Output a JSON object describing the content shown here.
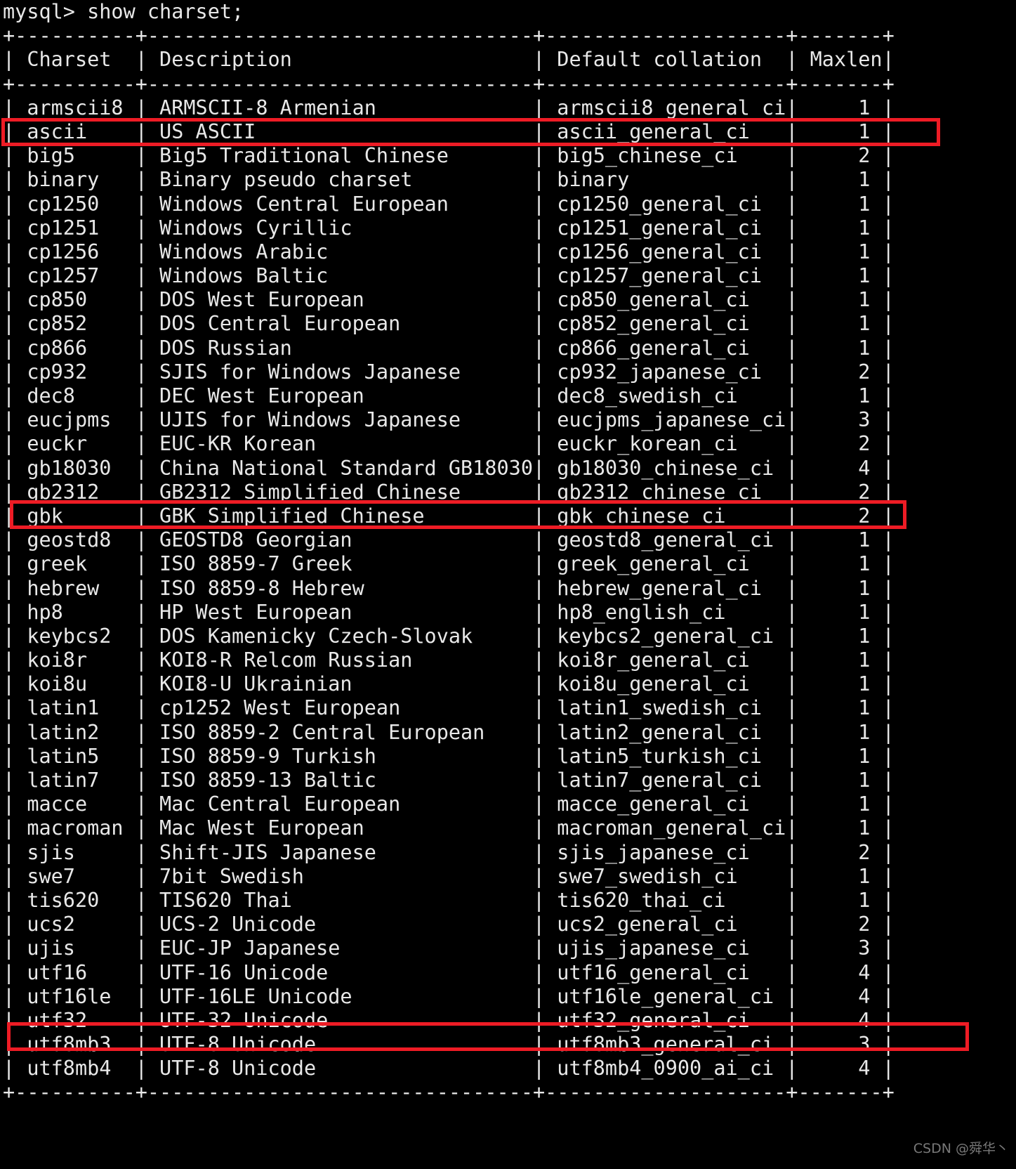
{
  "terminal": {
    "prompt": "mysql> show charset;",
    "separator": "+-----------+---------------------------------+---------------------+--------+",
    "header": {
      "charset": "Charset",
      "description": "Description",
      "collation": "Default collation",
      "maxlen": "Maxlen"
    },
    "columns": {
      "charset_width": 10,
      "description_width": 32,
      "collation_width": 20,
      "maxlen_width": 7
    },
    "rows": [
      {
        "charset": "armscii8",
        "description": "ARMSCII-8 Armenian",
        "collation": "armscii8_general_ci",
        "maxlen": "1",
        "highlighted": false
      },
      {
        "charset": "ascii",
        "description": "US ASCII",
        "collation": "ascii_general_ci",
        "maxlen": "1",
        "highlighted": true
      },
      {
        "charset": "big5",
        "description": "Big5 Traditional Chinese",
        "collation": "big5_chinese_ci",
        "maxlen": "2",
        "highlighted": false
      },
      {
        "charset": "binary",
        "description": "Binary pseudo charset",
        "collation": "binary",
        "maxlen": "1",
        "highlighted": false
      },
      {
        "charset": "cp1250",
        "description": "Windows Central European",
        "collation": "cp1250_general_ci",
        "maxlen": "1",
        "highlighted": false
      },
      {
        "charset": "cp1251",
        "description": "Windows Cyrillic",
        "collation": "cp1251_general_ci",
        "maxlen": "1",
        "highlighted": false
      },
      {
        "charset": "cp1256",
        "description": "Windows Arabic",
        "collation": "cp1256_general_ci",
        "maxlen": "1",
        "highlighted": false
      },
      {
        "charset": "cp1257",
        "description": "Windows Baltic",
        "collation": "cp1257_general_ci",
        "maxlen": "1",
        "highlighted": false
      },
      {
        "charset": "cp850",
        "description": "DOS West European",
        "collation": "cp850_general_ci",
        "maxlen": "1",
        "highlighted": false
      },
      {
        "charset": "cp852",
        "description": "DOS Central European",
        "collation": "cp852_general_ci",
        "maxlen": "1",
        "highlighted": false
      },
      {
        "charset": "cp866",
        "description": "DOS Russian",
        "collation": "cp866_general_ci",
        "maxlen": "1",
        "highlighted": false
      },
      {
        "charset": "cp932",
        "description": "SJIS for Windows Japanese",
        "collation": "cp932_japanese_ci",
        "maxlen": "2",
        "highlighted": false
      },
      {
        "charset": "dec8",
        "description": "DEC West European",
        "collation": "dec8_swedish_ci",
        "maxlen": "1",
        "highlighted": false
      },
      {
        "charset": "eucjpms",
        "description": "UJIS for Windows Japanese",
        "collation": "eucjpms_japanese_ci",
        "maxlen": "3",
        "highlighted": false
      },
      {
        "charset": "euckr",
        "description": "EUC-KR Korean",
        "collation": "euckr_korean_ci",
        "maxlen": "2",
        "highlighted": false
      },
      {
        "charset": "gb18030",
        "description": "China National Standard GB18030",
        "collation": "gb18030_chinese_ci",
        "maxlen": "4",
        "highlighted": false
      },
      {
        "charset": "gb2312",
        "description": "GB2312 Simplified Chinese",
        "collation": "gb2312_chinese_ci",
        "maxlen": "2",
        "highlighted": false
      },
      {
        "charset": "gbk",
        "description": "GBK Simplified Chinese",
        "collation": "gbk_chinese_ci",
        "maxlen": "2",
        "highlighted": true
      },
      {
        "charset": "geostd8",
        "description": "GEOSTD8 Georgian",
        "collation": "geostd8_general_ci",
        "maxlen": "1",
        "highlighted": false
      },
      {
        "charset": "greek",
        "description": "ISO 8859-7 Greek",
        "collation": "greek_general_ci",
        "maxlen": "1",
        "highlighted": false
      },
      {
        "charset": "hebrew",
        "description": "ISO 8859-8 Hebrew",
        "collation": "hebrew_general_ci",
        "maxlen": "1",
        "highlighted": false
      },
      {
        "charset": "hp8",
        "description": "HP West European",
        "collation": "hp8_english_ci",
        "maxlen": "1",
        "highlighted": false
      },
      {
        "charset": "keybcs2",
        "description": "DOS Kamenicky Czech-Slovak",
        "collation": "keybcs2_general_ci",
        "maxlen": "1",
        "highlighted": false
      },
      {
        "charset": "koi8r",
        "description": "KOI8-R Relcom Russian",
        "collation": "koi8r_general_ci",
        "maxlen": "1",
        "highlighted": false
      },
      {
        "charset": "koi8u",
        "description": "KOI8-U Ukrainian",
        "collation": "koi8u_general_ci",
        "maxlen": "1",
        "highlighted": false
      },
      {
        "charset": "latin1",
        "description": "cp1252 West European",
        "collation": "latin1_swedish_ci",
        "maxlen": "1",
        "highlighted": false
      },
      {
        "charset": "latin2",
        "description": "ISO 8859-2 Central European",
        "collation": "latin2_general_ci",
        "maxlen": "1",
        "highlighted": false
      },
      {
        "charset": "latin5",
        "description": "ISO 8859-9 Turkish",
        "collation": "latin5_turkish_ci",
        "maxlen": "1",
        "highlighted": false
      },
      {
        "charset": "latin7",
        "description": "ISO 8859-13 Baltic",
        "collation": "latin7_general_ci",
        "maxlen": "1",
        "highlighted": false
      },
      {
        "charset": "macce",
        "description": "Mac Central European",
        "collation": "macce_general_ci",
        "maxlen": "1",
        "highlighted": false
      },
      {
        "charset": "macroman",
        "description": "Mac West European",
        "collation": "macroman_general_ci",
        "maxlen": "1",
        "highlighted": false
      },
      {
        "charset": "sjis",
        "description": "Shift-JIS Japanese",
        "collation": "sjis_japanese_ci",
        "maxlen": "2",
        "highlighted": false
      },
      {
        "charset": "swe7",
        "description": "7bit Swedish",
        "collation": "swe7_swedish_ci",
        "maxlen": "1",
        "highlighted": false
      },
      {
        "charset": "tis620",
        "description": "TIS620 Thai",
        "collation": "tis620_thai_ci",
        "maxlen": "1",
        "highlighted": false
      },
      {
        "charset": "ucs2",
        "description": "UCS-2 Unicode",
        "collation": "ucs2_general_ci",
        "maxlen": "2",
        "highlighted": false
      },
      {
        "charset": "ujis",
        "description": "EUC-JP Japanese",
        "collation": "ujis_japanese_ci",
        "maxlen": "3",
        "highlighted": false
      },
      {
        "charset": "utf16",
        "description": "UTF-16 Unicode",
        "collation": "utf16_general_ci",
        "maxlen": "4",
        "highlighted": false
      },
      {
        "charset": "utf16le",
        "description": "UTF-16LE Unicode",
        "collation": "utf16le_general_ci",
        "maxlen": "4",
        "highlighted": false
      },
      {
        "charset": "utf32",
        "description": "UTF-32 Unicode",
        "collation": "utf32_general_ci",
        "maxlen": "4",
        "highlighted": false
      },
      {
        "charset": "utf8mb3",
        "description": "UTF-8 Unicode",
        "collation": "utf8mb3_general_ci",
        "maxlen": "3",
        "highlighted": true
      },
      {
        "charset": "utf8mb4",
        "description": "UTF-8 Unicode",
        "collation": "utf8mb4_0900_ai_ci",
        "maxlen": "4",
        "highlighted": false
      }
    ]
  },
  "annotations": {
    "highlight_color": "#ee1c25",
    "boxes": [
      {
        "target": "ascii"
      },
      {
        "target": "gbk"
      },
      {
        "target": "utf8mb3"
      }
    ]
  },
  "watermark": {
    "text": "CSDN @舜华丶"
  }
}
